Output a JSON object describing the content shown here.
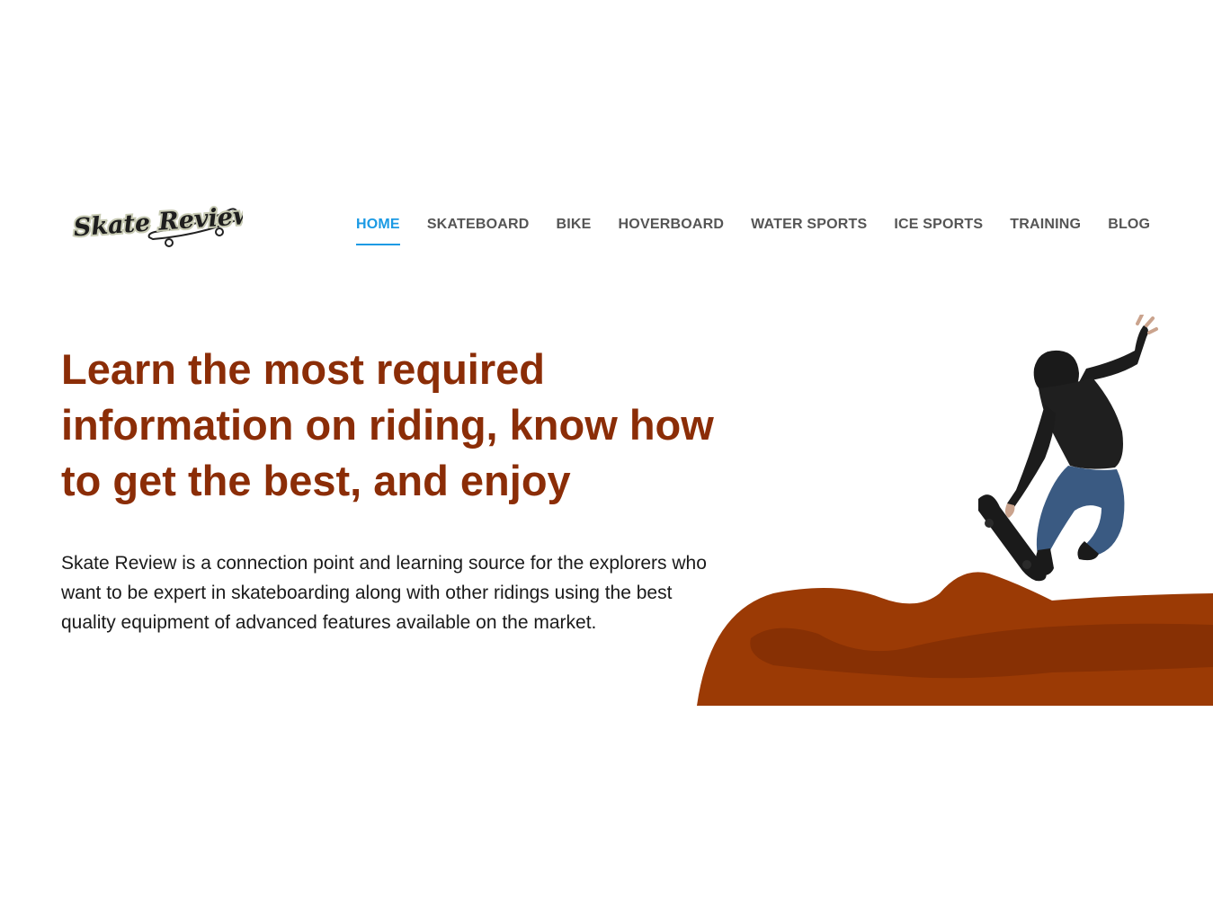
{
  "brand": {
    "logo_text": "Skate Review"
  },
  "nav": {
    "items": [
      {
        "label": "HOME",
        "active": true
      },
      {
        "label": "SKATEBOARD",
        "active": false
      },
      {
        "label": "BIKE",
        "active": false
      },
      {
        "label": "HOVERBOARD",
        "active": false
      },
      {
        "label": "WATER SPORTS",
        "active": false
      },
      {
        "label": "ICE SPORTS",
        "active": false
      },
      {
        "label": "TRAINING",
        "active": false
      },
      {
        "label": "BLOG",
        "active": false
      }
    ]
  },
  "hero": {
    "headline": "Learn the most required information on riding, know how to get the best, and enjoy",
    "description": "Skate Review is a connection point and learning source for the explorers who want to be expert in skateboarding along with other ridings using the best quality equipment of advanced features available on the market."
  },
  "colors": {
    "accent": "#1b9ae4",
    "headline": "#8b2d07",
    "nav_text": "#555555",
    "ramp": "#9b3a05",
    "ramp_shadow": "#873004",
    "body_text": "#1a1a1a"
  },
  "icons": {
    "logo": "skateboard-logo-icon",
    "hero": "skateboarder-illustration"
  }
}
